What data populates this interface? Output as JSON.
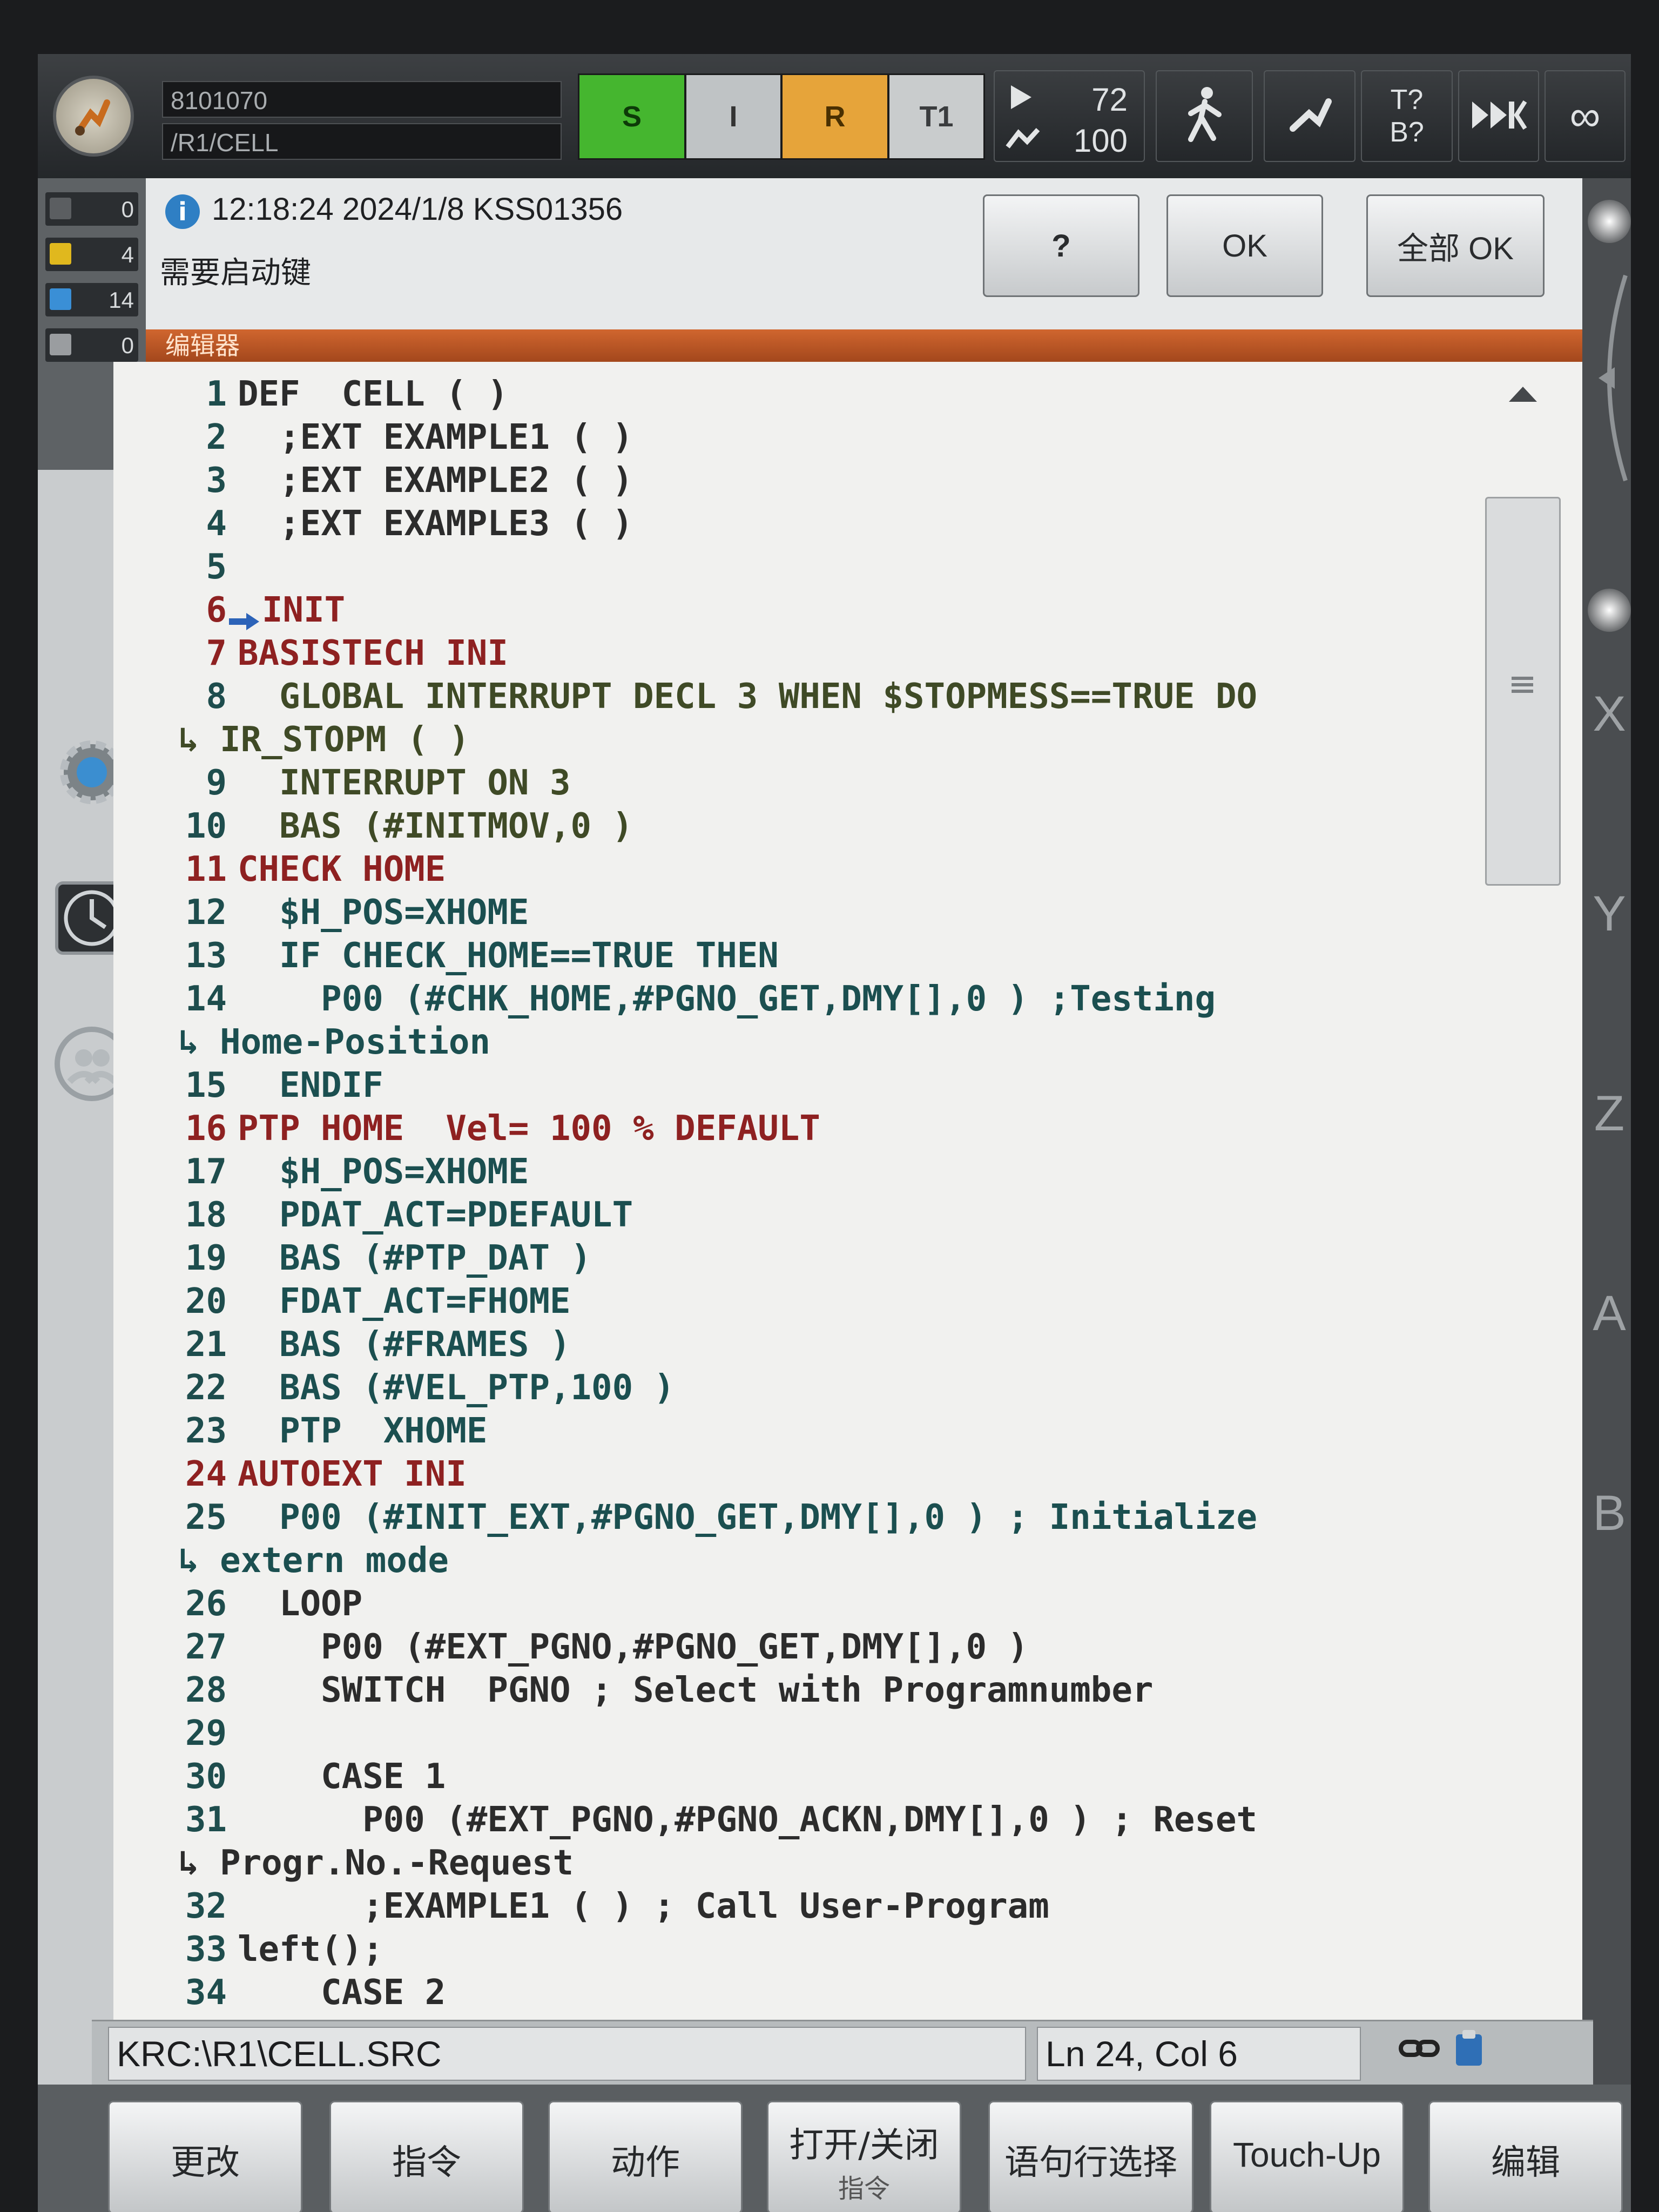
{
  "topbar": {
    "program_id": "8101070",
    "program_path": "/R1/CELL",
    "status_s": "S",
    "status_i": "I",
    "status_r": "R",
    "mode": "T1",
    "override_prog": "72",
    "override_jog": "100",
    "tool_base_tool": "T?",
    "tool_base_base": "B?",
    "run_mode_icon": "infinity-icon",
    "run_mode_text": "∞"
  },
  "counters": [
    {
      "value": "0",
      "color": "#5b5e61",
      "icon": "stop-msg-icon"
    },
    {
      "value": "4",
      "color": "#e0b81e",
      "icon": "warning-msg-icon"
    },
    {
      "value": "14",
      "color": "#3a8fd6",
      "icon": "info-msg-icon"
    },
    {
      "value": "0",
      "color": "#9a9da0",
      "icon": "wait-msg-icon"
    }
  ],
  "message": {
    "time": "12:18:24 2024/1/8 KSS01356",
    "text": "需要启动键",
    "help_label": "?",
    "ok_label": "OK",
    "all_ok_label": "全部 OK"
  },
  "editor": {
    "title": "编辑器",
    "lines": [
      {
        "n": "1",
        "text": "DEF  CELL ( )",
        "style": "c-grey",
        "indent": 0
      },
      {
        "n": "2",
        "text": "  ;EXT EXAMPLE1 ( )",
        "style": "c-grey",
        "indent": 0
      },
      {
        "n": "3",
        "text": "  ;EXT EXAMPLE2 ( )",
        "style": "c-grey",
        "indent": 0
      },
      {
        "n": "4",
        "text": "  ;EXT EXAMPLE3 ( )",
        "style": "c-grey",
        "indent": 0
      },
      {
        "n": "5",
        "text": "",
        "style": "c-grey",
        "indent": 0
      },
      {
        "n": "6",
        "text": "INIT",
        "style": "c-red",
        "indent": 0,
        "arrow": true
      },
      {
        "n": "7",
        "text": "BASISTECH INI",
        "style": "c-red",
        "indent": 0
      },
      {
        "n": "8",
        "text": "  GLOBAL INTERRUPT DECL 3 WHEN $STOPMESS==TRUE DO",
        "style": "c-olive",
        "indent": 0
      },
      {
        "n": "",
        "text": "↳ IR_STOPM ( )",
        "style": "c-olive",
        "indent": -1
      },
      {
        "n": "9",
        "text": "  INTERRUPT ON 3",
        "style": "c-olive",
        "indent": 0
      },
      {
        "n": "10",
        "text": "  BAS (#INITMOV,0 )",
        "style": "c-olive",
        "indent": 0
      },
      {
        "n": "11",
        "text": "CHECK HOME",
        "style": "c-red",
        "indent": 0
      },
      {
        "n": "12",
        "text": "  $H_POS=XHOME",
        "style": "c-teal",
        "indent": 0
      },
      {
        "n": "13",
        "text": "  IF CHECK_HOME==TRUE THEN",
        "style": "c-teal",
        "indent": 0
      },
      {
        "n": "14",
        "text": "    P00 (#CHK_HOME,#PGNO_GET,DMY[],0 ) ;Testing",
        "style": "c-teal",
        "indent": 0
      },
      {
        "n": "",
        "text": "↳ Home-Position",
        "style": "c-teal",
        "indent": -1
      },
      {
        "n": "15",
        "text": "  ENDIF",
        "style": "c-teal",
        "indent": 0
      },
      {
        "n": "16",
        "text": "PTP HOME  Vel= 100 % DEFAULT",
        "style": "c-red",
        "indent": 0
      },
      {
        "n": "17",
        "text": "  $H_POS=XHOME",
        "style": "c-teal",
        "indent": 0
      },
      {
        "n": "18",
        "text": "  PDAT_ACT=PDEFAULT",
        "style": "c-teal",
        "indent": 0
      },
      {
        "n": "19",
        "text": "  BAS (#PTP_DAT )",
        "style": "c-teal",
        "indent": 0
      },
      {
        "n": "20",
        "text": "  FDAT_ACT=FHOME",
        "style": "c-teal",
        "indent": 0
      },
      {
        "n": "21",
        "text": "  BAS (#FRAMES )",
        "style": "c-teal",
        "indent": 0
      },
      {
        "n": "22",
        "text": "  BAS (#VEL_PTP,100 )",
        "style": "c-teal",
        "indent": 0
      },
      {
        "n": "23",
        "text": "  PTP  XHOME",
        "style": "c-teal",
        "indent": 0
      },
      {
        "n": "24",
        "text": "AUTOEXT INI",
        "style": "c-red",
        "indent": 0
      },
      {
        "n": "25",
        "text": "  P00 (#INIT_EXT,#PGNO_GET,DMY[],0 ) ; Initialize",
        "style": "c-teal",
        "indent": 0
      },
      {
        "n": "",
        "text": "↳ extern mode",
        "style": "c-teal",
        "indent": -1
      },
      {
        "n": "26",
        "text": "  LOOP",
        "style": "c-grey",
        "indent": 0
      },
      {
        "n": "27",
        "text": "    P00 (#EXT_PGNO,#PGNO_GET,DMY[],0 )",
        "style": "c-grey",
        "indent": 0
      },
      {
        "n": "28",
        "text": "    SWITCH  PGNO ; Select with Programnumber",
        "style": "c-grey",
        "indent": 0
      },
      {
        "n": "29",
        "text": "",
        "style": "c-grey",
        "indent": 0
      },
      {
        "n": "30",
        "text": "    CASE 1",
        "style": "c-grey",
        "indent": 0
      },
      {
        "n": "31",
        "text": "      P00 (#EXT_PGNO,#PGNO_ACKN,DMY[],0 ) ; Reset",
        "style": "c-grey",
        "indent": 0
      },
      {
        "n": "",
        "text": "↳ Progr.No.-Request",
        "style": "c-grey",
        "indent": -1
      },
      {
        "n": "32",
        "text": "      ;EXAMPLE1 ( ) ; Call User-Program",
        "style": "c-grey",
        "indent": 0
      },
      {
        "n": "33",
        "text": "left();",
        "style": "c-grey",
        "indent": 0
      },
      {
        "n": "34",
        "text": "    CASE 2",
        "style": "c-grey",
        "indent": 0
      }
    ]
  },
  "statusbar": {
    "file_path": "KRC:\\R1\\CELL.SRC",
    "cursor_pos": "Ln 24, Col 6"
  },
  "right_axes": [
    "X",
    "Y",
    "Z",
    "A",
    "B"
  ],
  "softkeys": [
    "更改",
    "指令",
    "动作",
    "打开/关闭",
    "语句行选择",
    "Touch-Up",
    "编辑"
  ],
  "softkey_extra": "指令"
}
